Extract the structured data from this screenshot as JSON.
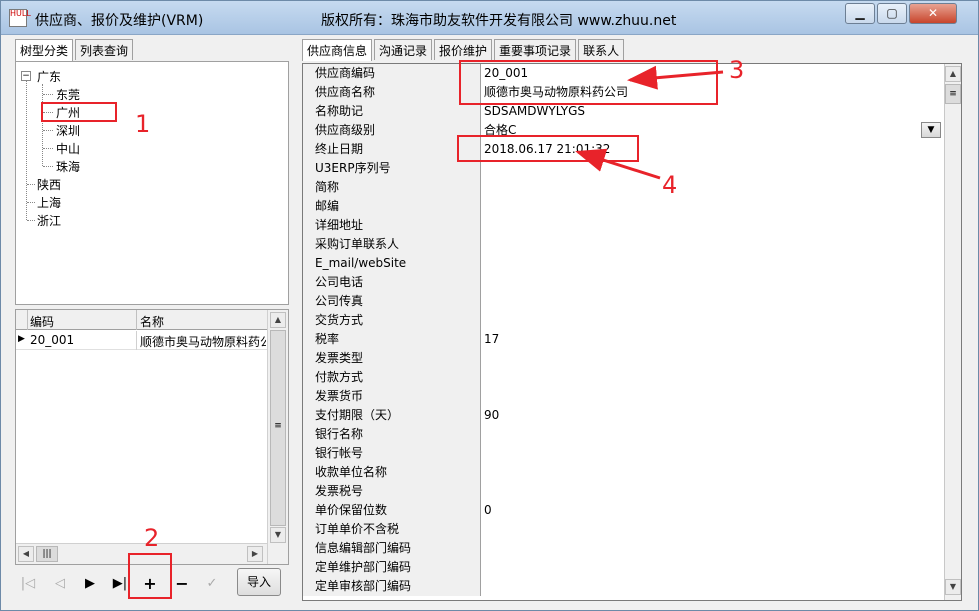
{
  "window": {
    "title": "供应商、报价及维护(VRM)",
    "copyright": "版权所有：珠海市助友软件开发有限公司 www.zhuu.net",
    "icon_text": "HULL"
  },
  "left_tabs": [
    {
      "label": "树型分类",
      "active": true
    },
    {
      "label": "列表查询",
      "active": false
    }
  ],
  "tree": {
    "root_nodes": [
      "广东",
      "陕西",
      "上海",
      "浙江"
    ],
    "guangdong_children": [
      "东莞",
      "广州",
      "深圳",
      "中山",
      "珠海"
    ]
  },
  "grid": {
    "columns": [
      "编码",
      "名称"
    ],
    "rows": [
      {
        "code": "20_001",
        "name": "顺德市奥马动物原料药公"
      }
    ]
  },
  "toolbar": {
    "first": "|◁",
    "prev": "◁",
    "next": "▶",
    "last": "▶|",
    "add": "+",
    "delete": "−",
    "confirm": "✓",
    "import_label": "导入"
  },
  "right_tabs": [
    {
      "label": "供应商信息",
      "active": true
    },
    {
      "label": "沟通记录",
      "active": false
    },
    {
      "label": "报价维护",
      "active": false
    },
    {
      "label": "重要事项记录",
      "active": false
    },
    {
      "label": "联系人",
      "active": false
    }
  ],
  "properties": [
    {
      "label": "供应商编码",
      "value": "20_001"
    },
    {
      "label": "供应商名称",
      "value": "顺德市奥马动物原料药公司"
    },
    {
      "label": "名称助记",
      "value": "SDSAMDWYLYGS"
    },
    {
      "label": "供应商级别",
      "value": "合格C"
    },
    {
      "label": "终止日期",
      "value": "2018.06.17 21:01:32"
    },
    {
      "label": "U3ERP序列号",
      "value": ""
    },
    {
      "label": "简称",
      "value": ""
    },
    {
      "label": "邮编",
      "value": ""
    },
    {
      "label": "详细地址",
      "value": ""
    },
    {
      "label": "采购订单联系人",
      "value": ""
    },
    {
      "label": "E_mail/webSite",
      "value": ""
    },
    {
      "label": "公司电话",
      "value": ""
    },
    {
      "label": "公司传真",
      "value": ""
    },
    {
      "label": "交货方式",
      "value": ""
    },
    {
      "label": "税率",
      "value": "17"
    },
    {
      "label": "发票类型",
      "value": ""
    },
    {
      "label": "付款方式",
      "value": ""
    },
    {
      "label": "发票货币",
      "value": ""
    },
    {
      "label": "支付期限（天）",
      "value": "90"
    },
    {
      "label": "银行名称",
      "value": ""
    },
    {
      "label": "银行帐号",
      "value": ""
    },
    {
      "label": "收款单位名称",
      "value": ""
    },
    {
      "label": "发票税号",
      "value": ""
    },
    {
      "label": "单价保留位数",
      "value": "0"
    },
    {
      "label": "订单单价不含税",
      "value": ""
    },
    {
      "label": "信息编辑部门编码",
      "value": ""
    },
    {
      "label": "定单维护部门编码",
      "value": ""
    },
    {
      "label": "定单审核部门编码",
      "value": ""
    }
  ],
  "annotations": [
    "1",
    "2",
    "3",
    "4"
  ],
  "colors": {
    "annotation": "#e8232a",
    "titlebar": "#b7cfe9"
  }
}
